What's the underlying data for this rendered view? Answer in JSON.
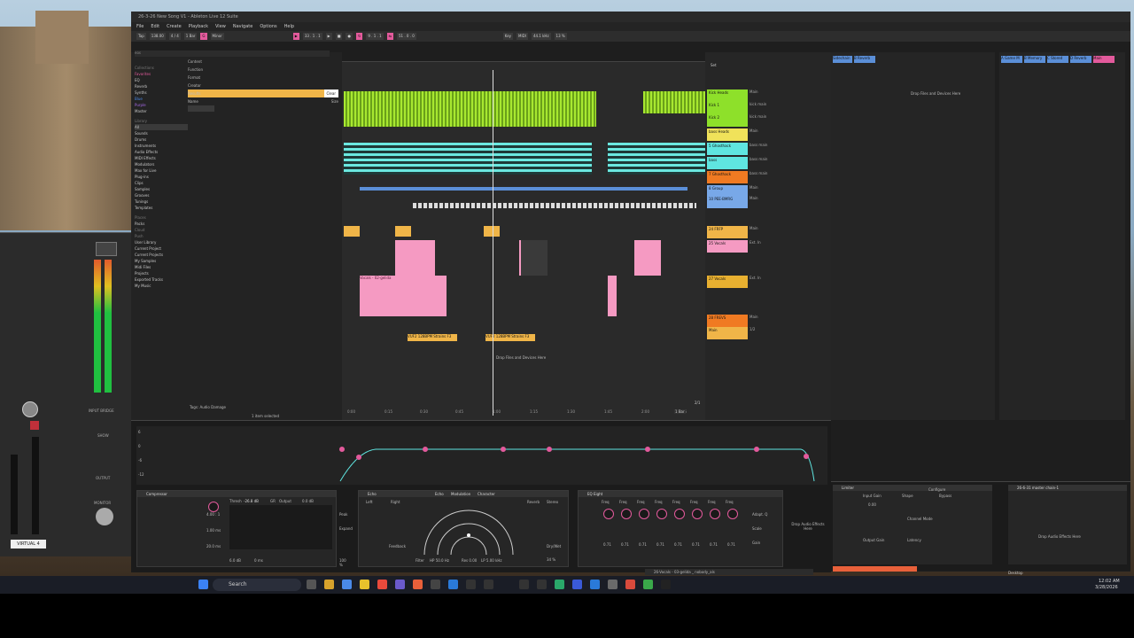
{
  "window": {
    "title": "26-3-26 New Song V1 - Ableton Live 12 Suite",
    "menus": [
      "File",
      "Edit",
      "Create",
      "Playback",
      "View",
      "Navigate",
      "Options",
      "Help"
    ]
  },
  "transport": {
    "tap": "Tap",
    "tempo": "138.00",
    "signature": "4 / 4",
    "quantize": "1 Bar",
    "key": "G",
    "scale": "Minor",
    "position": "33 . 1 . 1",
    "loop_start": "9 . 1 . 1",
    "loop_length": "51 . 0 . 0",
    "key_label": "Key",
    "midi_label": "MIDI",
    "sample_rate": "44.1 kHz",
    "cpu": "13 %"
  },
  "browser": {
    "search_placeholder": "eos",
    "collections_header": "Collections",
    "collections": [
      "Favorites",
      "EQ",
      "Reverb",
      "Synths",
      "Blue",
      "Purple",
      "Master"
    ],
    "library_header": "Library",
    "library": [
      "All",
      "Sounds",
      "Drums",
      "Instruments",
      "Audio Effects",
      "MIDI Effects",
      "Modulators",
      "Max for Live",
      "Plug-ins",
      "Clips",
      "Samples",
      "Grooves",
      "Tunings",
      "Templates"
    ],
    "places_header": "Places",
    "places": [
      "Packs",
      "Cloud",
      "Push",
      "User Library",
      "Current Project",
      "Current Projects",
      "My Samples",
      "Midi Files",
      "Projects",
      "Exported Tracks",
      "My Music"
    ],
    "filters": [
      "Content",
      "Function",
      "Format",
      "Creator"
    ],
    "results_label": "Results",
    "clear_label": "Clear",
    "name_col": "Name",
    "size_col": "Size",
    "tags_label": "Tags:",
    "tags_value": "Audio Damage",
    "status": "1 item selected"
  },
  "arrangement": {
    "drop_hint": "Drop Files and Devices Here",
    "clip_vocal": "Vocals - 02-gelida",
    "clip_vuf": "VUF2 128BPM Strains F3",
    "set_label": "Set",
    "time_marks": [
      "0:00",
      "0:15",
      "0:30",
      "0:45",
      "1:00",
      "1:15",
      "1:30",
      "1:45",
      "2:00",
      "2:15"
    ],
    "zoom_ratio": "2/1",
    "position_readout": "1 Bar"
  },
  "tracks": [
    {
      "name": "Kick Heads",
      "color": "#8ee02a",
      "output": "Main"
    },
    {
      "name": "Kick 1",
      "color": "#8ee02a",
      "output": "kick main"
    },
    {
      "name": "Kick 2",
      "color": "#8ee02a",
      "output": "kick main"
    },
    {
      "name": "bass Heads",
      "color": "#f0e25a",
      "output": "Main"
    },
    {
      "name": "5 Ghosthack",
      "color": "#5fe5e0",
      "output": "bass main"
    },
    {
      "name": "bass",
      "color": "#5fe5e0",
      "output": "bass main"
    },
    {
      "name": "7 Ghosthack",
      "color": "#f07a22",
      "output": "bass main"
    },
    {
      "name": "8 Group",
      "color": "#78a8e8",
      "output": "Main"
    },
    {
      "name": "10 PEE-BMRG",
      "color": "#78a8e8",
      "output": "Main"
    },
    {
      "name": "24 FRFP",
      "color": "#f0b548",
      "output": "Main"
    },
    {
      "name": "25 Vocals",
      "color": "#f59ac2",
      "output": "Ext. In"
    },
    {
      "name": "27 Vocals",
      "color": "#e8b030",
      "output": "Ext. In"
    },
    {
      "name": "28 FREVS",
      "color": "#f07a22",
      "output": "Main"
    },
    {
      "name": "Main",
      "color": "#f0b548",
      "output": "1/2"
    }
  ],
  "devices": {
    "compressor": {
      "name": "Compressor",
      "threshold_label": "Thresh",
      "threshold": "-26.8 dB",
      "gr": "GR",
      "output": "Output",
      "out_val": "0.0 dB",
      "ratio": "4.00 : 1",
      "attack": "1.00 ms",
      "release": "20.0 ms",
      "knee": "6.0 dB",
      "look": "0 ms",
      "peak": "Peak",
      "expand": "Expand",
      "dry_wet": "100 %"
    },
    "echo": {
      "name": "Echo",
      "tabs": [
        "Echo",
        "Modulation",
        "Character"
      ],
      "left": "Left",
      "right": "Right",
      "reverb": "Reverb",
      "stereo": "Stereo",
      "feedback": "Feedback",
      "dry_wet": "Dry/Wet",
      "filter": "Filter",
      "hp": "HP 50.0 Hz",
      "res": "Res 0.00",
      "lp": "LP 5.00 kHz",
      "dry_wet_val": "34 %"
    },
    "eq": {
      "name": "EQ Eight",
      "bands": [
        "Freq",
        "Freq",
        "Freq",
        "Freq",
        "Freq",
        "Freq",
        "Freq",
        "Freq"
      ],
      "gains": [
        "0.71",
        "0.71",
        "0.71",
        "0.71",
        "0.71",
        "0.71",
        "0.71",
        "0.71"
      ],
      "adapt": "Adapt. Q",
      "scale": "Scale",
      "gain": "Gain"
    },
    "drop_hint": "Drop Audio Effects Here"
  },
  "eq_curve": {
    "ylabels": [
      "6",
      "0",
      "-6",
      "-12"
    ]
  },
  "right_window": {
    "drop_hint": "Drop Files and Devices Here",
    "effects_hint": "Drop Audio Effects Here",
    "returns": [
      "A Game M",
      "B Memory",
      "C Stored",
      "D Reverb",
      "Main"
    ],
    "top_tabs": [
      "Sidechain",
      "B Reverb"
    ],
    "limiter": {
      "name": "Limiter",
      "input_gain": "Input Gain",
      "shape": "Shape",
      "configure": "Configure",
      "bypass": "Bypass",
      "output_gain": "Output Gain",
      "latency": "Latency",
      "ceiling": "0.00",
      "mode": "Channel Mode"
    },
    "chain_title": "26-6-31 master chain-1",
    "desktop_label": "Desktop"
  },
  "plugin_left": {
    "label": "VIRTUAL 4",
    "input_label": "INPUT BRIDGE",
    "show": "SHOW",
    "output": "OUTPUT",
    "monitor": "MONITOR"
  },
  "taskbar": {
    "search": "Search",
    "time": "12:02 AM",
    "date": "3/28/2026",
    "clip_name": "26-Vocals - 03-gelida _ nobody_als"
  }
}
